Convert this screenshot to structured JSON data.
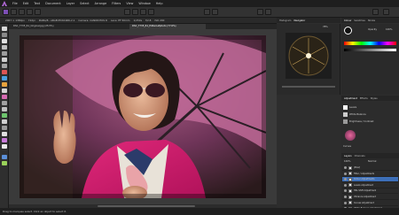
{
  "menubar": {
    "items": [
      "File",
      "Edit",
      "Text",
      "Document",
      "Layer",
      "Select",
      "Arrange",
      "Filters",
      "View",
      "Window",
      "Help"
    ]
  },
  "context_bar": {
    "items": [
      "2067 × 1380px",
      "72dpi",
      "RGBA/8 - sRGB IEC61966-2.1",
      "Camera: CANON EOS R",
      "Lens: EF 50mm",
      "1/250s",
      "f/2.8",
      "ISO 200"
    ]
  },
  "document": {
    "tab_label": "DSC_7735_R1_Edited.afphoto (77.6%)",
    "background_tab_label": "DSC_7735_R1_Original.jpg (25.5%)"
  },
  "right_panels": {
    "nav_tabs": [
      "Histogram",
      "Navigator"
    ],
    "color_tabs": [
      "Colour",
      "Swatches",
      "Stroke"
    ],
    "nav_zoom": "78%",
    "color_opacity_label": "Opacity",
    "color_opacity_value": "100%",
    "adj_tabs": [
      "Adjustment",
      "Effects",
      "Styles"
    ],
    "adj_items": [
      "Levels",
      "White Balance",
      "Brightness / Contrast",
      "Curves"
    ],
    "layers_tabs": [
      "Layers",
      "Channels"
    ],
    "layers_opacity": "100%",
    "layers_blend": "Normal",
    "layers": [
      {
        "name": "(Pixel)",
        "selected": false
      },
      {
        "name": "Filter / Adjustments",
        "selected": false
      },
      {
        "name": "Colour Adjustments",
        "selected": true
      },
      {
        "name": "Levels Adjustment",
        "selected": false
      },
      {
        "name": "HSL Shift Adjustment",
        "selected": false
      },
      {
        "name": "Vibrance Adjustment",
        "selected": false
      },
      {
        "name": "Curves Adjustment",
        "selected": false
      },
      {
        "name": "White Balance Adjustment",
        "selected": false
      },
      {
        "name": "Exposure Adjustment",
        "selected": false
      },
      {
        "name": "Background (Pixel)",
        "selected": false
      }
    ]
  },
  "status": {
    "text": "Drag to marquee select. Click an object to select it."
  },
  "colors": {
    "accent": "#3d6fb8",
    "panel": "#2a2a2a",
    "canvas": "#3a3a3a"
  }
}
